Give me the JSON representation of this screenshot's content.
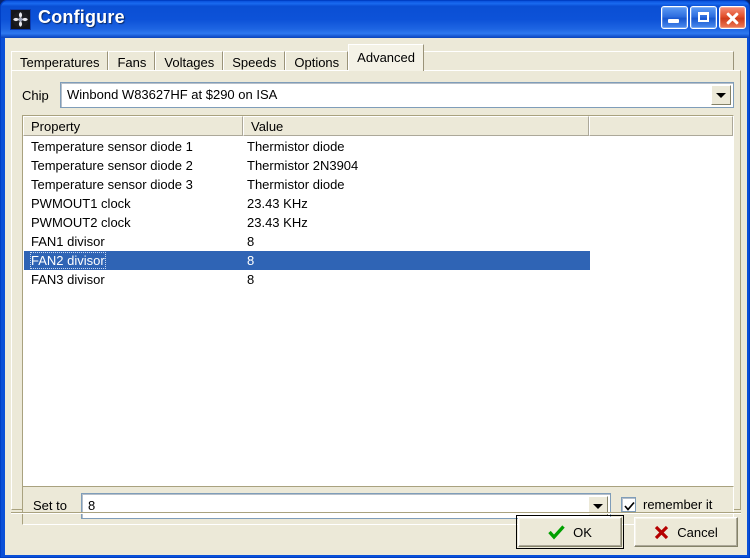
{
  "window": {
    "title": "Configure",
    "icon": "fan-icon",
    "caption_buttons": [
      {
        "name": "minimize-button",
        "icon": "minimize-icon",
        "label": "Minimize"
      },
      {
        "name": "maximize-button",
        "icon": "maximize-icon",
        "label": "Maximize"
      },
      {
        "name": "close-button",
        "icon": "close-icon",
        "label": "Close"
      }
    ],
    "accent_title_color": "#0d52d8",
    "client_background": "#ece9d8"
  },
  "tabs": [
    {
      "label": "Temperatures",
      "active": false
    },
    {
      "label": "Fans",
      "active": false
    },
    {
      "label": "Voltages",
      "active": false
    },
    {
      "label": "Speeds",
      "active": false
    },
    {
      "label": "Options",
      "active": false
    },
    {
      "label": "Advanced",
      "active": true
    }
  ],
  "chip": {
    "label": "Chip",
    "value": "Winbond W83627HF at $290 on ISA",
    "dropdown_icon": "chevron-down-icon"
  },
  "list": {
    "columns": [
      "Property",
      "Value",
      ""
    ],
    "selection_color": "#2f64b5",
    "selected_index": 6,
    "rows": [
      {
        "property": "Temperature sensor diode 1",
        "value": "Thermistor diode"
      },
      {
        "property": "Temperature sensor diode 2",
        "value": "Thermistor 2N3904"
      },
      {
        "property": "Temperature sensor diode 3",
        "value": "Thermistor diode"
      },
      {
        "property": "PWMOUT1 clock",
        "value": "23.43 KHz"
      },
      {
        "property": "PWMOUT2 clock",
        "value": "23.43 KHz"
      },
      {
        "property": "FAN1 divisor",
        "value": "8"
      },
      {
        "property": "FAN2 divisor",
        "value": "8"
      },
      {
        "property": "FAN3 divisor",
        "value": "8"
      }
    ]
  },
  "setto": {
    "label": "Set to",
    "value": "8",
    "dropdown_icon": "chevron-down-icon",
    "remember": {
      "label": "remember it",
      "checked": true,
      "icon": "checkmark-icon"
    }
  },
  "footer": {
    "ok": {
      "label": "OK",
      "icon": "check-icon",
      "icon_color": "#00a000",
      "default": true
    },
    "cancel": {
      "label": "Cancel",
      "icon": "cross-icon",
      "icon_color": "#b50000"
    }
  }
}
